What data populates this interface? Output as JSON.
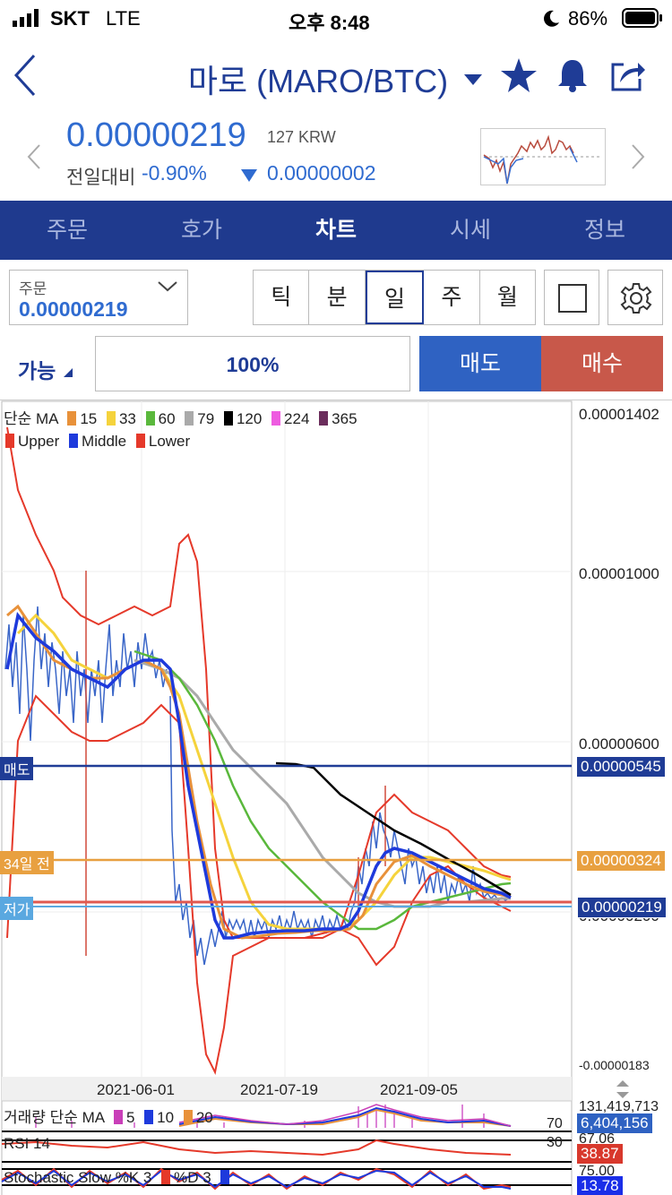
{
  "status_bar": {
    "carrier": "SKT",
    "network": "LTE",
    "time": "오후 8:48",
    "battery": "86%"
  },
  "header": {
    "title": "마로 (MARO/BTC)",
    "price": "0.00000219",
    "price_krw": "127 KRW",
    "diff_label": "전일대비",
    "diff_pct": "-0.90%",
    "diff_abs": "0.00000002"
  },
  "tabs": [
    {
      "label": "주문",
      "active": false
    },
    {
      "label": "호가",
      "active": false
    },
    {
      "label": "차트",
      "active": true
    },
    {
      "label": "시세",
      "active": false
    },
    {
      "label": "정보",
      "active": false
    }
  ],
  "order": {
    "label": "주문",
    "value": "0.00000219"
  },
  "periods": [
    {
      "label": "틱",
      "active": false
    },
    {
      "label": "분",
      "active": false
    },
    {
      "label": "일",
      "active": true
    },
    {
      "label": "주",
      "active": false
    },
    {
      "label": "월",
      "active": false
    }
  ],
  "trade": {
    "avail_label": "가능",
    "percent": "100%",
    "sell_label": "매도",
    "buy_label": "매수"
  },
  "chart": {
    "ma_legend": {
      "prefix": "단순 MA",
      "items": [
        {
          "label": "15",
          "color": "#e8913a"
        },
        {
          "label": "33",
          "color": "#f5d33c"
        },
        {
          "label": "60",
          "color": "#5ab83c"
        },
        {
          "label": "79",
          "color": "#aaaaaa"
        },
        {
          "label": "120",
          "color": "#000000"
        },
        {
          "label": "224",
          "color": "#ee5ce0"
        },
        {
          "label": "365",
          "color": "#6b2d5c"
        }
      ]
    },
    "bb_legend": [
      {
        "label": "Upper",
        "color": "#e5392a"
      },
      {
        "label": "Middle",
        "color": "#1e3adc"
      },
      {
        "label": "Lower",
        "color": "#e5392a"
      }
    ],
    "y_labels": [
      "0.00001402",
      "0.00001000",
      "0.00000600",
      "0.00000200",
      "-0.00000183"
    ],
    "price_tags": {
      "sell_label": "매도",
      "sell_value": "0.00000545",
      "ago_label": "34일 전",
      "ago_value": "0.00000324",
      "low_label": "저가",
      "current_value": "0.00000219"
    },
    "x_labels": [
      "2021-06-01",
      "2021-07-19",
      "2021-09-05"
    ],
    "volume": {
      "prefix": "거래량 단순 MA",
      "items": [
        {
          "label": "5",
          "color": "#c93fb8"
        },
        {
          "label": "10",
          "color": "#1e3adc"
        },
        {
          "label": "20",
          "color": "#e8913a"
        }
      ],
      "max": "131,419,713",
      "current": "6,404,156"
    },
    "rsi": {
      "label": "RSI 14",
      "level_high": "70",
      "level_low": "30",
      "top": "67.06",
      "value": "38.87"
    },
    "stochastic": {
      "label": "Stochastic Slow %K 3",
      "d_label": "%D 3",
      "top": "75.00",
      "value": "13.78"
    }
  }
}
